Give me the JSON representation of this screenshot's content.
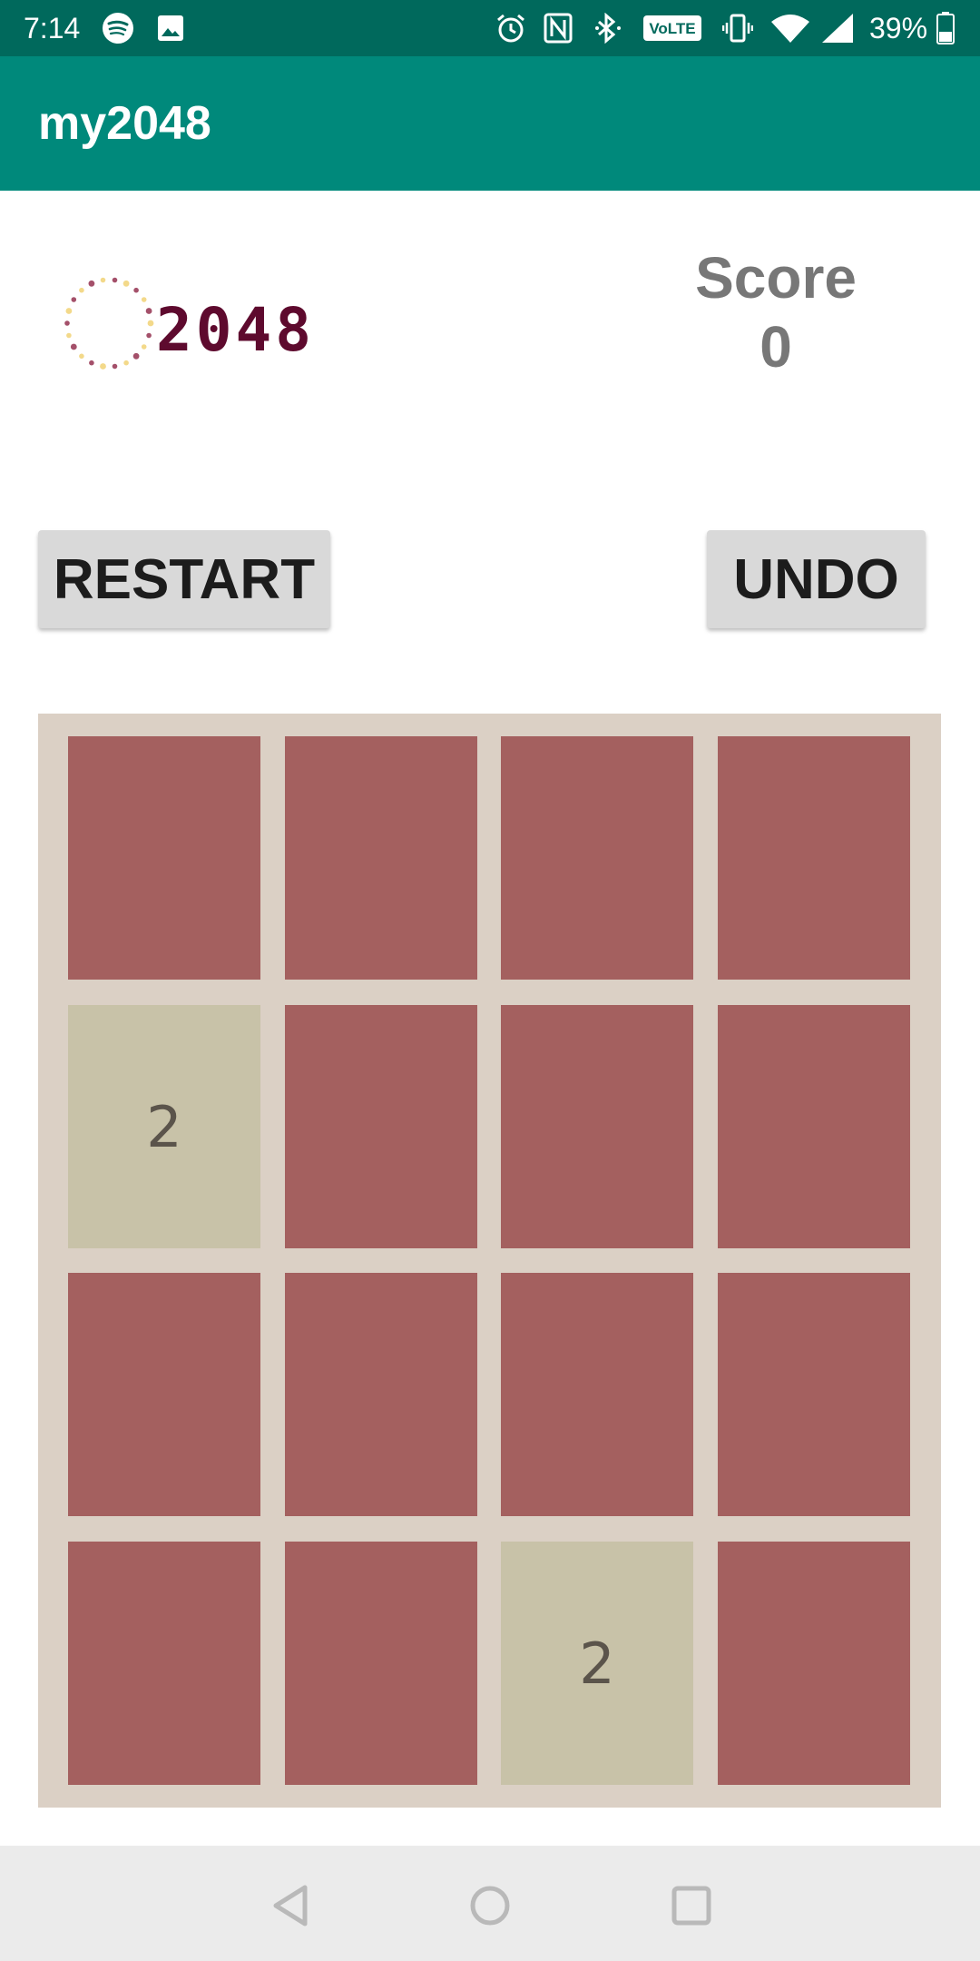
{
  "status_bar": {
    "time": "7:14",
    "battery_percent": "39%",
    "icons": [
      "spotify-icon",
      "image-icon",
      "alarm-icon",
      "nfc-icon",
      "bluetooth-icon",
      "volte-icon",
      "vibrate-icon",
      "wifi-icon",
      "signal-icon",
      "battery-icon"
    ],
    "volte_label": "VoLTE"
  },
  "app_bar": {
    "title": "my2048"
  },
  "logo": {
    "text": "2048"
  },
  "score": {
    "label": "Score",
    "value": "0"
  },
  "buttons": {
    "restart": "RESTART",
    "undo": "UNDO"
  },
  "board": {
    "rows": [
      [
        "",
        "",
        "",
        ""
      ],
      [
        "2",
        "",
        "",
        ""
      ],
      [
        "",
        "",
        "",
        ""
      ],
      [
        "",
        "",
        "2",
        ""
      ]
    ]
  },
  "colors": {
    "status_bar": "#00695c",
    "app_bar": "#00897b",
    "board_bg": "#dbd0c5",
    "empty_tile": "#a4605f",
    "tile_2": "#c8c2a8",
    "logo_text": "#5e0a2e"
  },
  "nav_bar": {
    "icons": [
      "back-icon",
      "home-icon",
      "recents-icon"
    ]
  }
}
